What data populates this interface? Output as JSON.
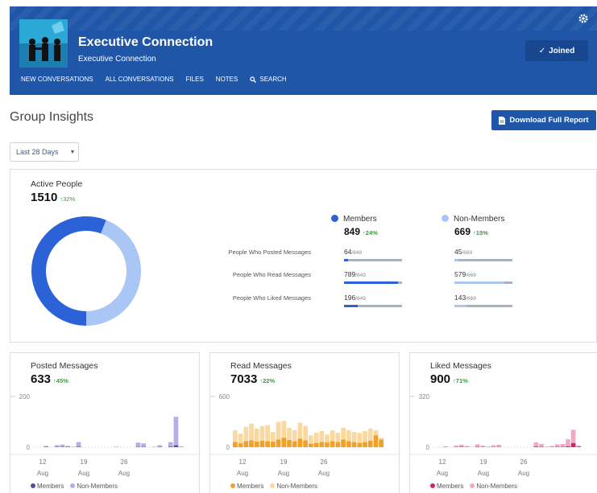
{
  "header": {
    "title": "Executive Connection",
    "subtitle": "Executive Connection",
    "joined_label": "Joined",
    "nav": [
      "NEW CONVERSATIONS",
      "ALL CONVERSATIONS",
      "FILES",
      "NOTES",
      "SEARCH"
    ]
  },
  "insights": {
    "title": "Group Insights",
    "download_label": "Download Full Report",
    "range_value": "Last 28 Days"
  },
  "active_people": {
    "label": "Active People",
    "value": "1510",
    "delta": "32%",
    "members": {
      "label": "Members",
      "value": "849",
      "delta": "24%"
    },
    "non_members": {
      "label": "Non-Members",
      "value": "669",
      "delta": "15%"
    },
    "rows": [
      {
        "label": "People Who Posted Messages",
        "members": "64",
        "members_total": "/849",
        "non_members": "45",
        "non_members_total": "/669"
      },
      {
        "label": "People Who Read Messages",
        "members": "789",
        "members_total": "/849",
        "non_members": "579",
        "non_members_total": "/669"
      },
      {
        "label": "People Who Liked Messages",
        "members": "196",
        "members_total": "/849",
        "non_members": "143",
        "non_members_total": "/669"
      }
    ],
    "colors": {
      "members": "#2c62d8",
      "non_members": "#a9c6f5"
    }
  },
  "cards": [
    {
      "label": "Posted Messages",
      "value": "633",
      "delta": "45%",
      "y_top": "200",
      "y_zero": "0"
    },
    {
      "label": "Read Messages",
      "value": "7033",
      "delta": "22%",
      "y_top": "600",
      "y_zero": "0"
    },
    {
      "label": "Liked Messages",
      "value": "900",
      "delta": "71%",
      "y_top": "320",
      "y_zero": "0"
    }
  ],
  "x_ticks": [
    {
      "day": "12",
      "month": "Aug"
    },
    {
      "day": "19",
      "month": "Aug"
    },
    {
      "day": "26",
      "month": "Aug"
    }
  ],
  "legend": {
    "members": "Members",
    "non_members": "Non-Members"
  },
  "chart_data": [
    {
      "type": "bar",
      "title": "Posted Messages",
      "ylim": [
        0,
        200
      ],
      "colors": {
        "members": "#5a4aa8",
        "non_members": "#b6aee6"
      },
      "series": [
        {
          "name": "Members",
          "values": [
            0,
            0,
            1,
            0,
            1,
            1,
            1,
            0,
            2,
            0,
            0,
            0,
            0,
            0,
            0,
            0,
            0,
            0,
            0,
            1,
            1,
            0,
            0,
            1,
            0,
            2,
            7,
            1
          ]
        },
        {
          "name": "Non-Members",
          "values": [
            0,
            0,
            5,
            0,
            8,
            10,
            5,
            2,
            20,
            0,
            0,
            0,
            0,
            0,
            0,
            2,
            0,
            0,
            0,
            18,
            15,
            0,
            2,
            8,
            0,
            20,
            120,
            2
          ]
        }
      ]
    },
    {
      "type": "bar",
      "title": "Read Messages",
      "ylim": [
        0,
        600
      ],
      "colors": {
        "members": "#f0a12a",
        "non_members": "#fad9a0"
      },
      "series": [
        {
          "name": "Members",
          "values": [
            60,
            45,
            70,
            80,
            65,
            75,
            70,
            65,
            90,
            110,
            85,
            70,
            100,
            80,
            40,
            50,
            60,
            55,
            70,
            60,
            90,
            70,
            60,
            50,
            60,
            75,
            140,
            90
          ]
        },
        {
          "name": "Non-Members",
          "values": [
            200,
            160,
            240,
            280,
            220,
            250,
            260,
            180,
            300,
            310,
            230,
            200,
            290,
            250,
            140,
            170,
            190,
            150,
            200,
            170,
            230,
            200,
            180,
            170,
            190,
            220,
            200,
            110
          ]
        }
      ]
    },
    {
      "type": "bar",
      "title": "Liked Messages",
      "ylim": [
        0,
        320
      ],
      "colors": {
        "members": "#c9256f",
        "non_members": "#f4a6c9"
      },
      "series": [
        {
          "name": "Members",
          "values": [
            0,
            0,
            1,
            0,
            1,
            2,
            1,
            0,
            2,
            1,
            0,
            1,
            1,
            0,
            0,
            0,
            0,
            0,
            0,
            4,
            2,
            0,
            1,
            2,
            2,
            5,
            25,
            3
          ]
        },
        {
          "name": "Non-Members",
          "values": [
            0,
            0,
            5,
            0,
            10,
            15,
            8,
            2,
            18,
            10,
            5,
            12,
            15,
            0,
            0,
            0,
            0,
            0,
            0,
            30,
            20,
            4,
            8,
            18,
            20,
            50,
            110,
            10
          ]
        }
      ]
    }
  ]
}
